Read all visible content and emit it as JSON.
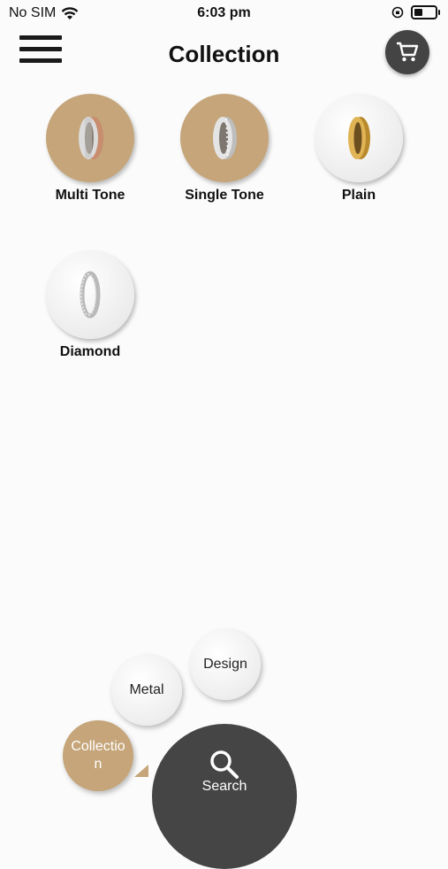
{
  "status": {
    "carrier": "No SIM",
    "time": "6:03 pm"
  },
  "header": {
    "title": "Collection"
  },
  "collections": [
    {
      "label": "Multi Tone",
      "style": "gold",
      "ring": "multi"
    },
    {
      "label": "Single Tone",
      "style": "gold",
      "ring": "single"
    },
    {
      "label": "Plain",
      "style": "white",
      "ring": "plain"
    },
    {
      "label": "Diamond",
      "style": "white",
      "ring": "diamond"
    }
  ],
  "nav": {
    "design": "Design",
    "metal": "Metal",
    "collection": "Collectio\nn",
    "search": "Search"
  },
  "colors": {
    "accent": "#c5a579",
    "dark": "#454545"
  }
}
